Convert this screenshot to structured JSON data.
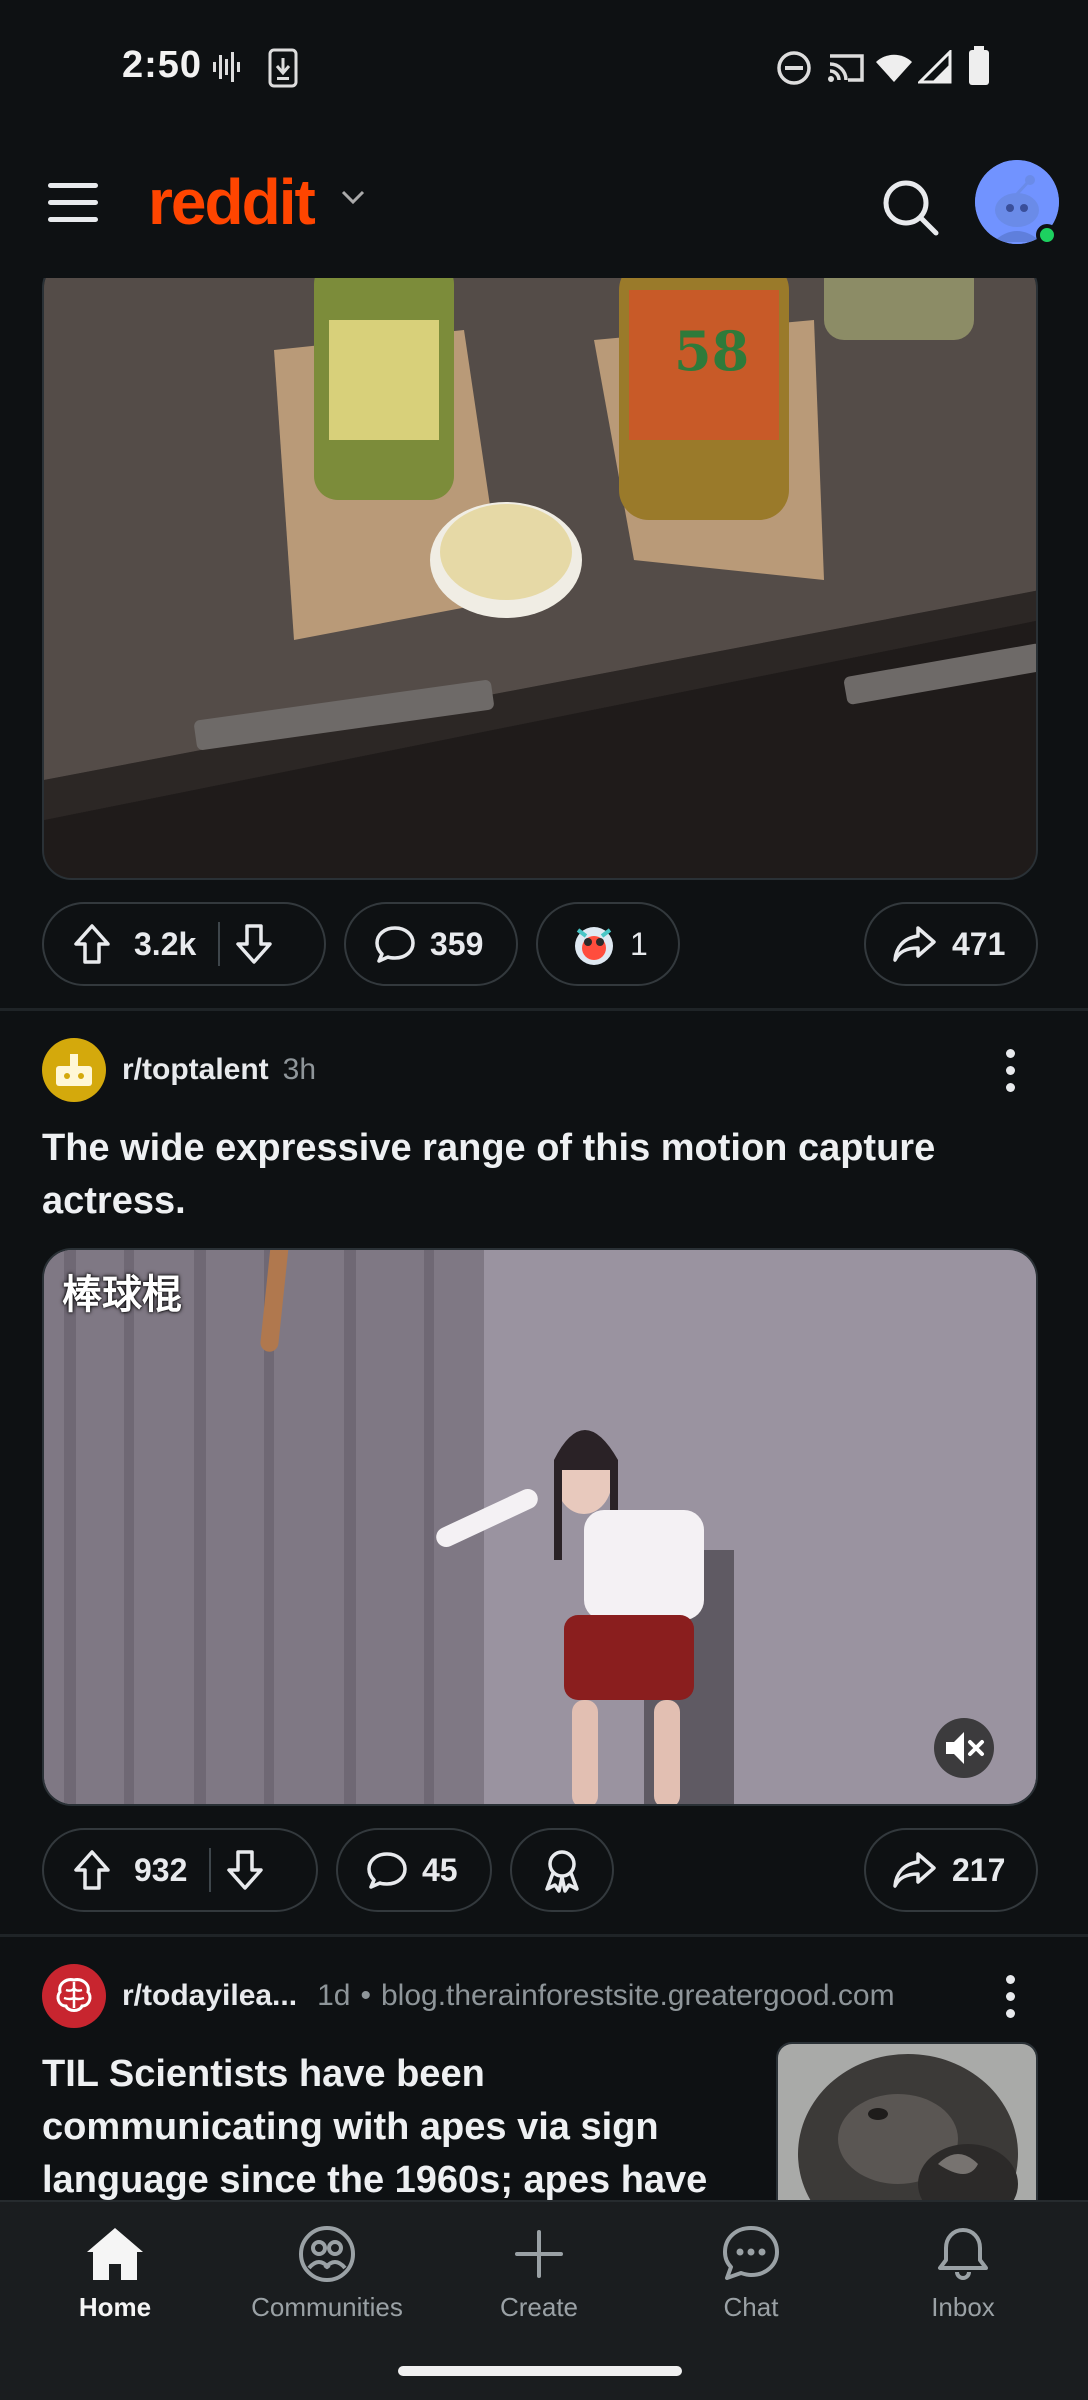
{
  "status_bar": {
    "time": "2:50",
    "left_icons": [
      "voicemail-waveform-icon",
      "download-phone-icon"
    ],
    "right_icons": [
      "do-not-disturb-icon",
      "cast-icon",
      "wifi-icon",
      "signal-icon",
      "battery-icon"
    ]
  },
  "header": {
    "logo": "reddit",
    "icons": [
      "hamburger-menu-icon",
      "chevron-down-icon",
      "search-icon",
      "avatar"
    ],
    "online_color": "#1dd160"
  },
  "posts": [
    {
      "image_desc": "pickle-jars-on-desk",
      "upvotes": "3.2k",
      "comments": "359",
      "awards": "1",
      "shares": "471"
    },
    {
      "subreddit": "r/toptalent",
      "age": "3h",
      "title_lines": [
        "The wide expressive range of this motion capture",
        "actress."
      ],
      "video_caption": "棒球棍",
      "upvotes": "932",
      "comments": "45",
      "shares": "217"
    },
    {
      "subreddit": "r/todayilea...",
      "age": "1d",
      "separator": "•",
      "domain": "blog.therainforestsite.greatergood.com",
      "title_lines": [
        "TIL Scientists have been",
        "communicating with apes via sign",
        "language since the 1960s; apes have"
      ]
    }
  ],
  "bottom_nav": [
    {
      "label": "Home",
      "icon": "home-icon",
      "active": true
    },
    {
      "label": "Communities",
      "icon": "communities-icon",
      "active": false
    },
    {
      "label": "Create",
      "icon": "plus-icon",
      "active": false
    },
    {
      "label": "Chat",
      "icon": "chat-icon",
      "active": false
    },
    {
      "label": "Inbox",
      "icon": "bell-icon",
      "active": false
    }
  ],
  "colors": {
    "background": "#0e1113",
    "brand": "#ff4500",
    "text": "#e8eaed",
    "muted": "#8e9599",
    "pill_border": "#33393d"
  }
}
